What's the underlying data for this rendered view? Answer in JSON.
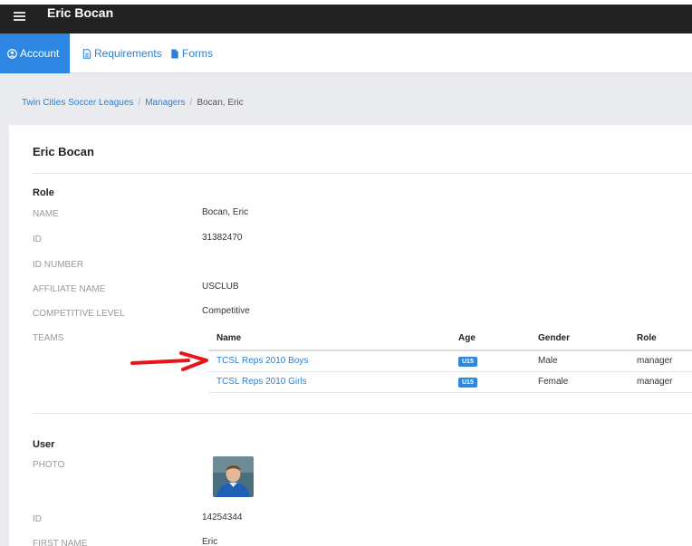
{
  "header": {
    "title": "Eric Bocan",
    "menu_icon": "hamburger-menu-icon"
  },
  "tabs": [
    {
      "label": "Account",
      "icon": "user-circle-icon",
      "active": true
    },
    {
      "label": "Requirements",
      "icon": "document-icon",
      "active": false
    },
    {
      "label": "Forms",
      "icon": "file-icon",
      "active": false
    }
  ],
  "breadcrumb": [
    "Twin Cities Soccer Leagues",
    "Managers",
    "Bocan, Eric"
  ],
  "card_title": "Eric Bocan",
  "role_section": {
    "title": "Role",
    "fields": [
      {
        "label": "NAME",
        "value": "Bocan, Eric"
      },
      {
        "label": "ID",
        "value": "31382470"
      },
      {
        "label": "ID NUMBER",
        "value": ""
      },
      {
        "label": "AFFILIATE NAME",
        "value": "USCLUB"
      },
      {
        "label": "COMPETITIVE LEVEL",
        "value": "Competitive"
      }
    ],
    "teams_label": "TEAMS",
    "teams": {
      "headers": [
        "Name",
        "Age",
        "Gender",
        "Role"
      ],
      "rows": [
        {
          "name": "TCSL Reps 2010 Boys",
          "age": "U15",
          "gender": "Male",
          "role": "manager"
        },
        {
          "name": "TCSL Reps 2010 Girls",
          "age": "U15",
          "gender": "Female",
          "role": "manager"
        }
      ]
    }
  },
  "user_section": {
    "title": "User",
    "photo_label": "PHOTO",
    "fields": [
      {
        "label": "ID",
        "value": "14254344"
      },
      {
        "label": "FIRST NAME",
        "value": "Eric"
      }
    ]
  },
  "colors": {
    "accent": "#2d87e2",
    "link": "#2a7fd4",
    "arrow": "#e8141b",
    "topbar": "#222222"
  }
}
